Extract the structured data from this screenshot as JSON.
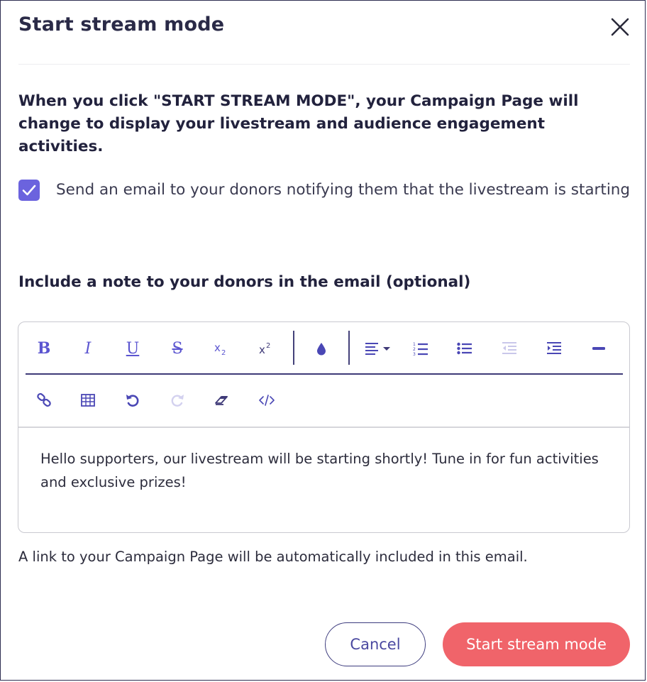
{
  "dialog": {
    "title": "Start stream mode",
    "intro": "When you click \"START STREAM MODE\", your Campaign Page will change to display your livestream and audience engagement activities.",
    "email_checkbox": {
      "checked": true,
      "label": "Send an email to your donors notifying them that the livestream is starting"
    },
    "note_label": "Include a note to your donors in the email (optional)",
    "editor": {
      "toolbar_row1": [
        "bold-icon",
        "italic-icon",
        "underline-icon",
        "strikethrough-icon",
        "subscript-icon",
        "superscript-icon",
        "color-drop-icon",
        "align-icon",
        "ordered-list-icon",
        "unordered-list-icon",
        "outdent-icon",
        "indent-icon",
        "horizontal-rule-icon"
      ],
      "toolbar_row2": [
        "link-icon",
        "table-icon",
        "undo-icon",
        "redo-icon",
        "eraser-icon",
        "code-view-icon"
      ],
      "text": "Hello supporters, our livestream will be starting shortly! Tune in for fun activities and exclusive prizes!"
    },
    "helper_text": "A link to your Campaign Page will be automatically included in this email.",
    "buttons": {
      "cancel": "Cancel",
      "start": "Start stream mode"
    },
    "colors": {
      "accent": "#6b63de",
      "primary_button": "#f0646a",
      "title": "#2a2a47"
    }
  }
}
